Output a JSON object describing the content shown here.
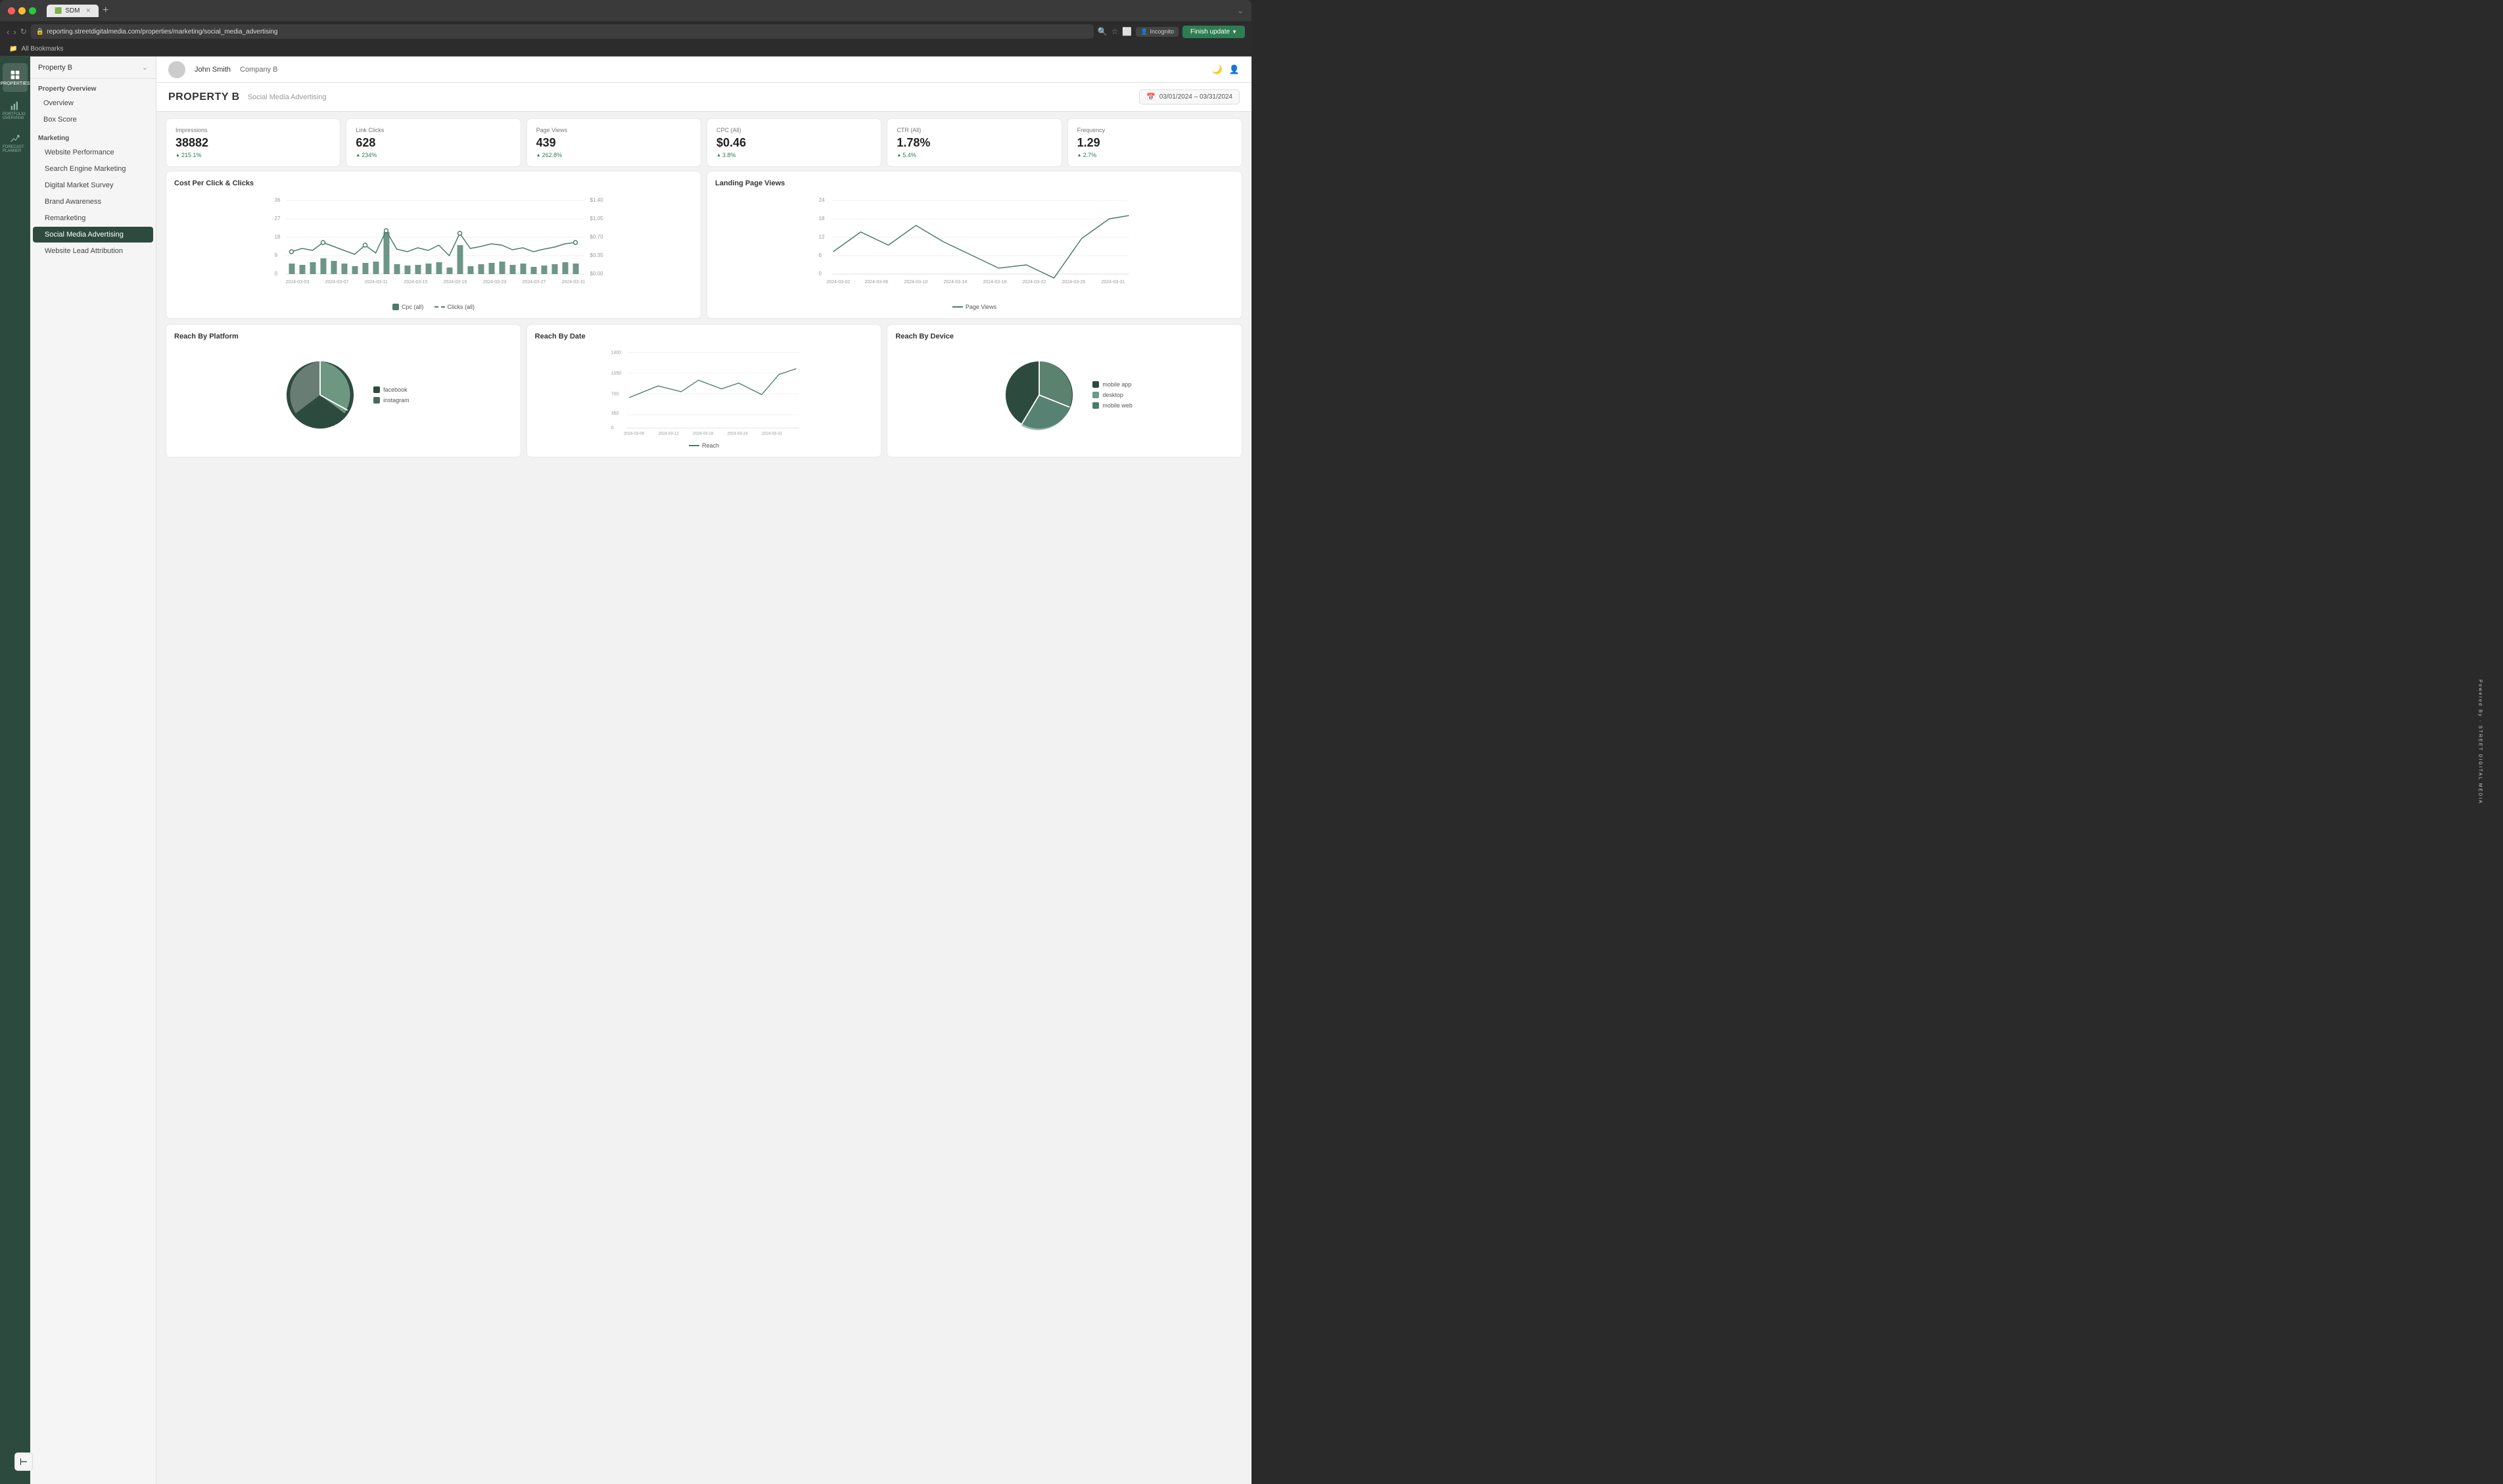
{
  "browser": {
    "tab_label": "SDM",
    "url": "reporting.streetdigitalmedia.com/properties/marketing/social_media_advertising",
    "finish_update": "Finish update",
    "incognito": "Incognito",
    "bookmarks_label": "All Bookmarks"
  },
  "top_header": {
    "user_name": "John Smith",
    "company_name": "Company B"
  },
  "nav": {
    "property": "Property B",
    "sections": {
      "property_overview": "Property Overview",
      "overview": "Overview",
      "box_score": "Box Score",
      "marketing": "Marketing",
      "website_performance": "Website Performance",
      "search_engine_marketing": "Search Engine Marketing",
      "digital_market_survey": "Digital Market Survey",
      "brand_awareness": "Brand Awareness",
      "remarketing": "Remarketing",
      "social_media_advertising": "Social Media Advertising",
      "website_lead_attribution": "Website Lead Attribution"
    },
    "sidebar_icons": {
      "properties": "PROPERTIES",
      "portfolio_overview": "PORTFOLIO OVERVIEW",
      "forecast_planner": "FORECAST PLANNER"
    }
  },
  "main": {
    "title": "PROPERTY B",
    "subtitle": "Social Media Advertising",
    "date_range": "03/01/2024 – 03/31/2024"
  },
  "metrics": [
    {
      "label": "Impressions",
      "value": "38882",
      "change": "215.1%",
      "direction": "up"
    },
    {
      "label": "Link Clicks",
      "value": "628",
      "change": "234%",
      "direction": "up"
    },
    {
      "label": "Page Views",
      "value": "439",
      "change": "262.8%",
      "direction": "up"
    },
    {
      "label": "CPC (All)",
      "value": "$0.46",
      "change": "3.8%",
      "direction": "up"
    },
    {
      "label": "CTR (All)",
      "value": "1.78%",
      "change": "5.4%",
      "direction": "up"
    },
    {
      "label": "Frequency",
      "value": "1.29",
      "change": "2.7%",
      "direction": "up"
    }
  ],
  "charts": {
    "cpc_clicks_title": "Cost Per Click & Clicks",
    "landing_page_views_title": "Landing Page Views",
    "reach_platform_title": "Reach By Platform",
    "reach_date_title": "Reach By Date",
    "reach_device_title": "Reach By Device",
    "legend_cpc": "Cpc (all)",
    "legend_clicks": "Clicks (all)",
    "legend_page_views": "Page Views",
    "legend_reach": "Reach",
    "platform_legend": [
      "facebook",
      "instagram"
    ],
    "device_legend": [
      "mobile app",
      "desktop",
      "mobile web"
    ]
  },
  "watermark": "Powered By · STREET DIGITAL MEDIA"
}
